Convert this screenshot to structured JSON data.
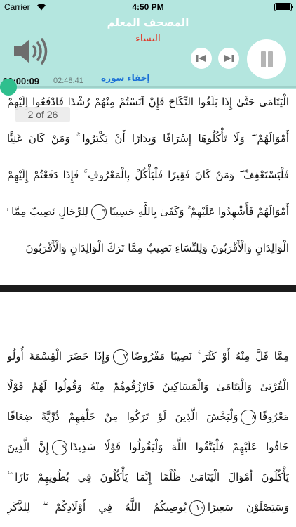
{
  "status_bar": {
    "carrier": "Carrier",
    "time": "4:50 PM"
  },
  "player": {
    "app_title": "المصحف المعلم",
    "surah_name": "النساء",
    "elapsed_time": "00:00:09",
    "total_time": "02:48:41",
    "hide_surah_label": "إخفاء سورة",
    "progress_fraction": 0.001,
    "colors": {
      "header_bg": "#b4e6df",
      "surah_name": "#e03a2a",
      "link": "#1a6fd6",
      "progress_thumb": "#2fbf8e"
    },
    "icons": [
      "wifi-icon",
      "battery-icon",
      "volume-icon",
      "previous-icon",
      "next-icon",
      "pause-icon"
    ]
  },
  "page_counter": "2 of 26",
  "page_top": {
    "lines": [
      {
        "text": "الْيَتَامَىٰ حَتَّىٰ إِذَا بَلَغُوا النِّكَاحَ فَإِنْ آنَسْتُمْ مِنْهُمْ رُشْدًا فَادْفَعُوا إِلَيْهِمْ"
      },
      {
        "text": "أَمْوَالَهُمْ ۖ وَلَا تَأْكُلُوهَا إِسْرَافًا وَبِدَارًا أَنْ يَكْبَرُوا ۚ وَمَنْ كَانَ غَنِيًّا"
      },
      {
        "text": "فَلْيَسْتَعْفِفْ ۖ وَمَنْ كَانَ فَقِيرًا فَلْيَأْكُلْ بِالْمَعْرُوفِ ۚ فَإِذَا دَفَعْتُمْ إِلَيْهِمْ"
      },
      {
        "text": "أَمْوَالَهُمْ فَأَشْهِدُوا عَلَيْهِمْ ۚ وَكَفَىٰ بِاللَّهِ حَسِيبًا",
        "marker": "٦",
        "after": "لِلرِّجَالِ نَصِيبٌ مِمَّا تَرَكَ"
      },
      {
        "text": "الْوَالِدَانِ وَالْأَقْرَبُونَ وَلِلنِّسَاءِ نَصِيبٌ مِمَّا تَرَكَ الْوَالِدَانِ وَالْأَقْرَبُونَ",
        "short": true
      }
    ]
  },
  "page_bottom": {
    "lines": [
      {
        "text": "مِمَّا قَلَّ مِنْهُ أَوْ كَثُرَ ۚ نَصِيبًا مَفْرُوضًا",
        "marker": "٧",
        "after": "وَإِذَا حَضَرَ الْقِسْمَةَ أُولُو"
      },
      {
        "text": "الْقُرْبَىٰ وَالْيَتَامَىٰ وَالْمَسَاكِينُ فَارْزُقُوهُمْ مِنْهُ وَقُولُوا لَهُمْ قَوْلًا"
      },
      {
        "text": "مَعْرُوفًا",
        "marker": "٨",
        "after": "وَلْيَخْشَ الَّذِينَ لَوْ تَرَكُوا مِنْ خَلْفِهِمْ ذُرِّيَّةً ضِعَافًا"
      },
      {
        "text": "خَافُوا عَلَيْهِمْ فَلْيَتَّقُوا اللَّهَ وَلْيَقُولُوا قَوْلًا سَدِيدًا",
        "marker": "٩",
        "after": "إِنَّ الَّذِينَ"
      },
      {
        "text": "يَأْكُلُونَ أَمْوَالَ الْيَتَامَىٰ ظُلْمًا إِنَّمَا يَأْكُلُونَ فِي بُطُونِهِمْ نَارًا ۖ"
      },
      {
        "text": "وَسَيَصْلَوْنَ سَعِيرًا",
        "marker": "١٠",
        "after": "يُوصِيكُمُ اللَّهُ فِي أَوْلَادِكُمْ ۖ لِلذَّكَرِ"
      }
    ]
  }
}
